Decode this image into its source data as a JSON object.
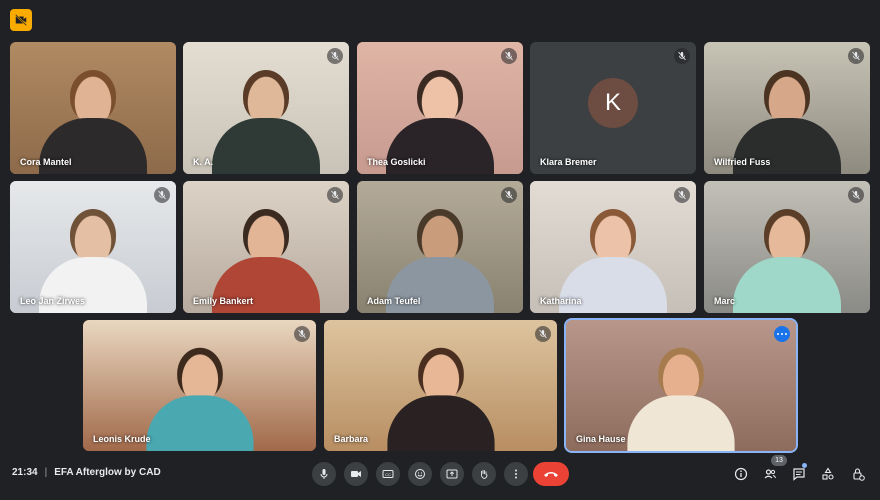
{
  "meeting": {
    "time": "21:34",
    "separator": "|",
    "title": "EFA Afterglow by CAD",
    "participant_count": "13"
  },
  "participants": [
    {
      "name": "Cora Mantel",
      "muted": false,
      "bg": "#8d6a4a",
      "wall": "#b08a62",
      "skin": "#e0b394",
      "hair": "#7a4f2e",
      "shirt": "#2c2a2a"
    },
    {
      "name": "K. A.",
      "muted": true,
      "bg": "#c9c3b7",
      "wall": "#e3ddd2",
      "skin": "#dfb799",
      "hair": "#5a3b27",
      "shirt": "#2f3a36"
    },
    {
      "name": "Thea Goslicki",
      "muted": true,
      "bg": "#c79a8f",
      "wall": "#dfb5a6",
      "skin": "#eec2a6",
      "hair": "#3a2a22",
      "shirt": "#2a2428"
    },
    {
      "name": "Klara Bremer",
      "muted": true,
      "initial": "K",
      "bg": "#3c4043"
    },
    {
      "name": "Wilfried Fuss",
      "muted": true,
      "bg": "#8e8a7f",
      "wall": "#c7c3b5",
      "skin": "#d6a788",
      "hair": "#4b3322",
      "shirt": "#2b2d2c"
    },
    {
      "name": "Leo Jan Zirwes",
      "muted": true,
      "bg": "#c8ccd2",
      "wall": "#e6e8ea",
      "skin": "#e4bfa4",
      "hair": "#6f5238",
      "shirt": "#f2f2f2"
    },
    {
      "name": "Emily Bankert",
      "muted": true,
      "bg": "#b7aa9e",
      "wall": "#dcd3c6",
      "skin": "#e2b597",
      "hair": "#3a2a20",
      "shirt": "#b04636"
    },
    {
      "name": "Adam Teufel",
      "muted": true,
      "bg": "#8a8270",
      "wall": "#b3ab98",
      "skin": "#c99c7b",
      "hair": "#4a3a2a",
      "shirt": "#8c96a0"
    },
    {
      "name": "Katharina",
      "muted": true,
      "bg": "#c5bfb8",
      "wall": "#e3dcd4",
      "skin": "#ecc3a8",
      "hair": "#8a5a38",
      "shirt": "#d9dde8"
    },
    {
      "name": "Marc",
      "muted": true,
      "bg": "#8a8a86",
      "wall": "#c2c0b7",
      "skin": "#e6b99a",
      "hair": "#5a3e28",
      "shirt": "#9fd8c8"
    },
    {
      "name": "Leonis Krude",
      "muted": true,
      "bg": "#a1694a",
      "wall": "#e9d7c0",
      "skin": "#e5b796",
      "hair": "#3d2a1d",
      "shirt": "#4aa8b0"
    },
    {
      "name": "Barbara",
      "muted": true,
      "bg": "#b88e62",
      "wall": "#ddc49f",
      "skin": "#e8b896",
      "hair": "#4a2f20",
      "shirt": "#2a2222"
    },
    {
      "name": "Gina Hause",
      "muted": false,
      "active": true,
      "bg": "#8e6c5d",
      "wall": "#b8968a",
      "skin": "#e6b08e",
      "hair": "#a67c4e",
      "shirt": "#efe6d6"
    }
  ],
  "controls": {
    "icons": [
      "microphone-icon",
      "camera-icon",
      "captions-icon",
      "emoji-icon",
      "present-icon",
      "raise-hand-icon",
      "more-options-icon"
    ],
    "hangup_icon": "hang-up-icon",
    "right_icons": [
      "info-icon",
      "people-icon",
      "chat-icon",
      "activities-icon",
      "host-controls-icon"
    ]
  },
  "colors": {
    "background": "#202124",
    "hangup": "#ea4335",
    "active_border": "#8ab4f8",
    "badge": "#f9ab00"
  }
}
